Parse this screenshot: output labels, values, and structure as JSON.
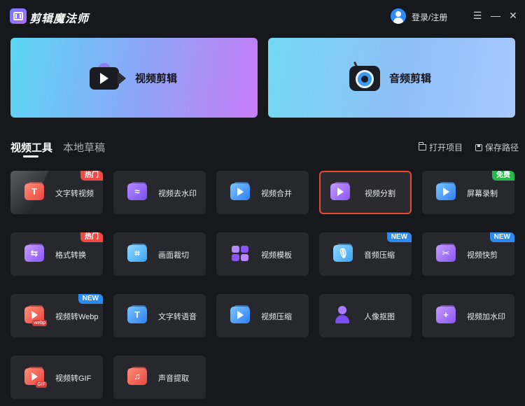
{
  "app": {
    "title": "剪辑魔法师"
  },
  "header": {
    "login_label": "登录/注册",
    "menu_icon": "☰",
    "min_icon": "—",
    "close_icon": "✕"
  },
  "hero": {
    "video": {
      "label": "视频剪辑",
      "icon": "video-camera-icon"
    },
    "audio": {
      "label": "音频剪辑",
      "icon": "audio-mic-icon"
    }
  },
  "tabs": [
    {
      "label": "视频工具",
      "active": true
    },
    {
      "label": "本地草稿",
      "active": false
    }
  ],
  "actions": {
    "open_project": "打开项目",
    "save_path": "保存路径"
  },
  "tools": [
    {
      "label": "文字转视频",
      "badge": "热门",
      "badge_type": "hot",
      "icon": "text-to-video-icon",
      "glyph": "T"
    },
    {
      "label": "视频去水印",
      "badge": "",
      "icon": "remove-watermark-icon",
      "glyph": "≈"
    },
    {
      "label": "视频合并",
      "badge": "",
      "icon": "video-merge-icon",
      "glyph": ""
    },
    {
      "label": "视频分割",
      "badge": "",
      "icon": "video-split-icon",
      "glyph": "",
      "selected": true
    },
    {
      "label": "屏幕录制",
      "badge": "免费",
      "badge_type": "free",
      "icon": "screen-record-icon",
      "glyph": ""
    },
    {
      "label": "格式转换",
      "badge": "热门",
      "badge_type": "hot",
      "icon": "format-convert-icon",
      "glyph": "⇆"
    },
    {
      "label": "画面裁切",
      "badge": "",
      "icon": "crop-icon",
      "glyph": "⌗"
    },
    {
      "label": "视频模板",
      "badge": "",
      "icon": "video-template-icon",
      "glyph": ""
    },
    {
      "label": "音频压缩",
      "badge": "NEW",
      "badge_type": "new",
      "icon": "audio-compress-icon",
      "glyph": "🎙"
    },
    {
      "label": "视频快剪",
      "badge": "NEW",
      "badge_type": "new",
      "icon": "quick-cut-icon",
      "glyph": "✂"
    },
    {
      "label": "视频转Webp",
      "badge": "NEW",
      "badge_type": "new",
      "icon": "video-to-webp-icon",
      "glyph": "",
      "mini": "webp"
    },
    {
      "label": "文字转语音",
      "badge": "",
      "icon": "text-to-speech-icon",
      "glyph": "T"
    },
    {
      "label": "视频压缩",
      "badge": "",
      "icon": "video-compress-icon",
      "glyph": ""
    },
    {
      "label": "人像抠图",
      "badge": "",
      "icon": "portrait-cutout-icon",
      "glyph": ""
    },
    {
      "label": "视频加水印",
      "badge": "",
      "icon": "add-watermark-icon",
      "glyph": "+"
    },
    {
      "label": "视频转GIF",
      "badge": "",
      "icon": "video-to-gif-icon",
      "glyph": "",
      "mini": "GIF"
    },
    {
      "label": "声音提取",
      "badge": "",
      "icon": "audio-extract-icon",
      "glyph": "♫"
    }
  ],
  "colors": {
    "bg": "#17181c",
    "card": "#26282e",
    "hot": "#f04a46",
    "new": "#2c8bf0",
    "free": "#28b84f",
    "selected_border": "#e8492f"
  }
}
